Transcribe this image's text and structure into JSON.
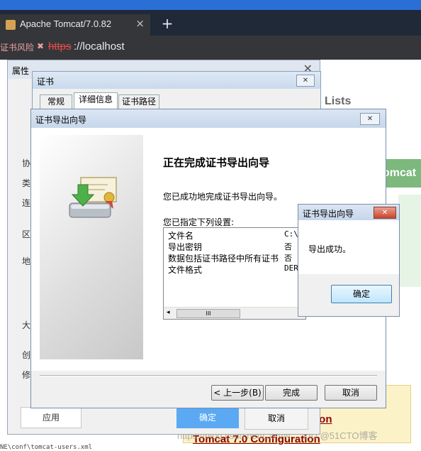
{
  "browser": {
    "tab_title": "Apache Tomcat/7.0.82",
    "tab_close": "×",
    "new_tab": "+",
    "security_warning": "证书风险",
    "security_mark": "✖",
    "url_scheme": "https",
    "url_rest": "://localhost"
  },
  "page": {
    "lists_heading": "Lists",
    "tomcat_banner": "omcat",
    "link_fragment": "ion",
    "config_link": "Tomcat 7.0 Configuration",
    "watermark": "https://blog.csdn.net/LJFVN ... LIU @51CTO博客",
    "bottom_code": "NE\\conf\\tomcat-users.xml"
  },
  "properties_dialog": {
    "title": "属性",
    "close": "✕",
    "side_labels": [
      "协",
      "类",
      "连",
      "区",
      "地",
      "大",
      "创",
      "修"
    ],
    "apply": "应用",
    "ok": "确定",
    "cancel": "取消"
  },
  "certificate_dialog": {
    "title": "证书",
    "close": "✕",
    "tabs": [
      "常规",
      "详细信息",
      "证书路径"
    ]
  },
  "export_wizard": {
    "title": "证书导出向导",
    "close": "✕",
    "heading": "正在完成证书导出向导",
    "message": "您已成功地完成证书导出向导。",
    "settings_label": "您已指定下列设置:",
    "settings": [
      {
        "name": "文件名",
        "value": "C:\\"
      },
      {
        "name": "导出密钥",
        "value": "否"
      },
      {
        "name": "数据包括证书路径中所有证书",
        "value": "否"
      },
      {
        "name": "文件格式",
        "value": "DER"
      }
    ],
    "scroll_left": "◂",
    "scroll_thumb": "III",
    "back_button": "< 上一步(B)",
    "finish_button": "完成",
    "cancel_button": "取消"
  },
  "success_popup": {
    "title": "证书导出向导",
    "close": "✕",
    "message": "导出成功。",
    "ok": "确定"
  },
  "colors": {
    "tab_strip": "#1f2937",
    "address_bar": "#35363a",
    "ok_blue": "#5aa9f2",
    "popup_close_red": "#c9452e",
    "tomcat_green": "#7db87d"
  }
}
